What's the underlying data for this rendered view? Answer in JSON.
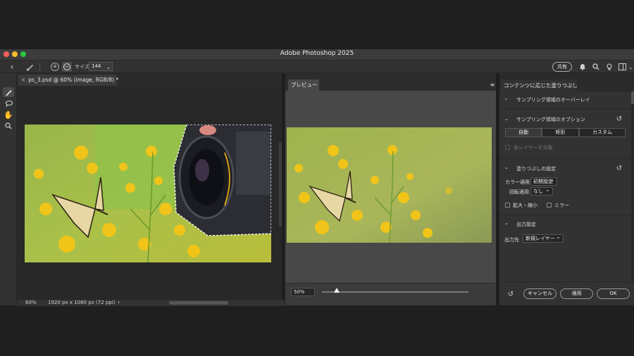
{
  "window": {
    "title": "Adobe Photoshop 2025"
  },
  "options_bar": {
    "size_label": "サイズ",
    "size_value": "144",
    "share_label": "共有"
  },
  "document": {
    "tab_label": "ps_3.psd @ 60% (image, RGB/8) *"
  },
  "status": {
    "zoom": "60%",
    "dimensions": "1920 px x 1080 px (72 ppi)"
  },
  "preview": {
    "tab_label": "プレビュー",
    "zoom_value": "50%",
    "zoom_fraction": 0.1
  },
  "panel": {
    "tab_label": "コンテンツに応じた塗りつぶし",
    "sampling_overlay": "サンプリング領域のオーバーレイ",
    "sampling_options": "サンプリング領域のオプション",
    "modes": [
      "自動",
      "矩形",
      "カスタム"
    ],
    "all_layers": "全レイヤーを対象",
    "fill_settings": "塗りつぶしの設定",
    "color_adapt_label": "カラー適用",
    "color_adapt_value": "初期設定",
    "rotation_label": "回転適用",
    "rotation_value": "なし",
    "scale_label": "拡大・縮小",
    "mirror_label": "ミラー",
    "output_settings": "出力設定",
    "output_to_label": "出力先",
    "output_to_value": "新規レイヤー",
    "cancel_label": "キャンセル",
    "apply_label": "適用",
    "ok_label": "OK"
  }
}
